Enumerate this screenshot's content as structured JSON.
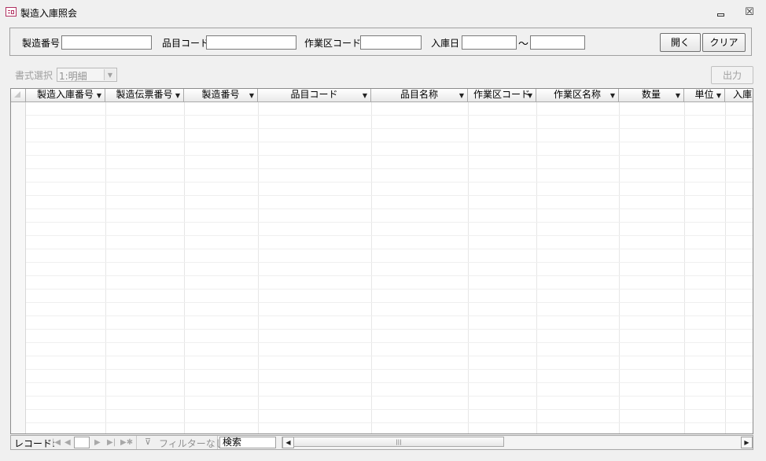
{
  "window": {
    "title": "製造入庫照会"
  },
  "header": {
    "mfg_no_label": "製造番号",
    "item_code_label": "品目コード",
    "work_area_label": "作業区コード",
    "receipt_date_label": "入庫日",
    "range_sep": "〜",
    "open_button": "開く",
    "clear_button": "クリア"
  },
  "format": {
    "label": "書式選択",
    "value": "1:明細",
    "output_button": "出力"
  },
  "grid": {
    "columns": [
      "製造入庫番号",
      "製造伝票番号",
      "製造番号",
      "品目コード",
      "品目名称",
      "作業区コード",
      "作業区名称",
      "数量",
      "単位",
      "入庫"
    ]
  },
  "navbar": {
    "record_label": "レコード:",
    "filter_label": "フィルターなし",
    "search_label": "検索"
  }
}
